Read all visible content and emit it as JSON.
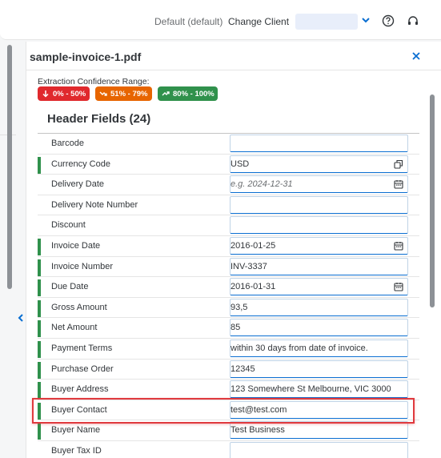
{
  "shell": {
    "client_default": "Default (default)",
    "change_client": "Change Client",
    "icons": [
      "chevron-down-icon",
      "help-icon",
      "headset-icon"
    ]
  },
  "panel": {
    "title": "sample-invoice-1.pdf",
    "confidence_label": "Extraction Confidence Range:",
    "badges": [
      {
        "label": "0% - 50%",
        "color": "#e0292d"
      },
      {
        "label": "51% - 79%",
        "color": "#e76500"
      },
      {
        "label": "80% - 100%",
        "color": "#30914c"
      }
    ],
    "section_title": "Header Fields (24)"
  },
  "fields": [
    {
      "label": "Barcode",
      "value": "",
      "placeholder": "",
      "confidence": "none",
      "icon": ""
    },
    {
      "label": "Currency Code",
      "value": "USD",
      "placeholder": "",
      "confidence": "high",
      "icon": "copy-icon"
    },
    {
      "label": "Delivery Date",
      "value": "",
      "placeholder": "e.g. 2024-12-31",
      "confidence": "none",
      "icon": "calendar-icon"
    },
    {
      "label": "Delivery Note Number",
      "value": "",
      "placeholder": "",
      "confidence": "none",
      "icon": ""
    },
    {
      "label": "Discount",
      "value": "",
      "placeholder": "",
      "confidence": "none",
      "icon": ""
    },
    {
      "label": "Invoice Date",
      "value": "2016-01-25",
      "placeholder": "",
      "confidence": "high",
      "icon": "calendar-icon"
    },
    {
      "label": "Invoice Number",
      "value": "INV-3337",
      "placeholder": "",
      "confidence": "high",
      "icon": ""
    },
    {
      "label": "Due Date",
      "value": "2016-01-31",
      "placeholder": "",
      "confidence": "high",
      "icon": "calendar-icon"
    },
    {
      "label": "Gross Amount",
      "value": "93,5",
      "placeholder": "",
      "confidence": "high",
      "icon": ""
    },
    {
      "label": "Net Amount",
      "value": "85",
      "placeholder": "",
      "confidence": "high",
      "icon": ""
    },
    {
      "label": "Payment Terms",
      "value": "within 30 days from date of invoice.",
      "placeholder": "",
      "confidence": "high",
      "icon": ""
    },
    {
      "label": "Purchase Order",
      "value": "12345",
      "placeholder": "",
      "confidence": "high",
      "icon": ""
    },
    {
      "label": "Buyer Address",
      "value": "123 Somewhere St Melbourne, VIC 3000",
      "placeholder": "",
      "confidence": "high",
      "icon": ""
    },
    {
      "label": "Buyer Contact",
      "value": "test@test.com",
      "placeholder": "",
      "confidence": "high",
      "icon": ""
    },
    {
      "label": "Buyer Name",
      "value": "Test Business",
      "placeholder": "",
      "confidence": "high",
      "icon": ""
    },
    {
      "label": "Buyer Tax ID",
      "value": "",
      "placeholder": "",
      "confidence": "none",
      "icon": ""
    }
  ],
  "highlighted_field": "Buyer Contact"
}
